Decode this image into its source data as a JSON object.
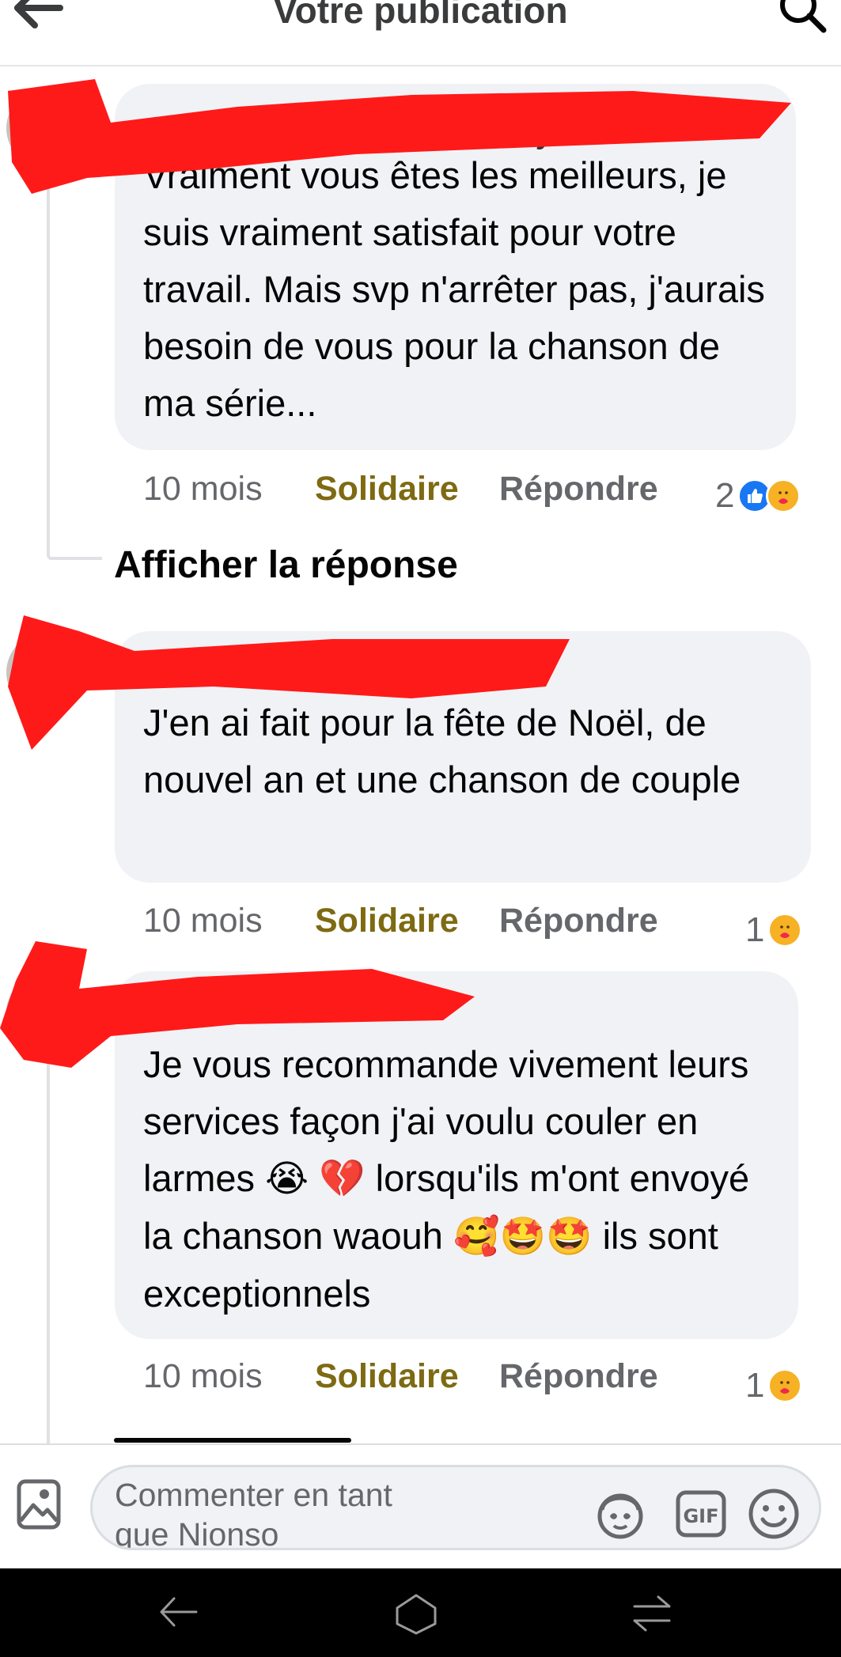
{
  "header": {
    "title": "Votre publication",
    "back_icon": "arrow-left-icon",
    "search_icon": "search-icon"
  },
  "comments": [
    {
      "text": "Vraiment vous êtes les meilleurs, je suis vraiment satisfait pour votre travail. Mais svp n'arrêter pas, j'aurais besoin de vous pour la chanson de ma série...",
      "time": "10 mois",
      "like_label": "Solidaire",
      "reply_label": "Répondre",
      "reaction_count": "2",
      "reactions": [
        "like",
        "care"
      ]
    },
    {
      "text": "J'en ai fait pour la fête de Noël, de nouvel an et une chanson de couple",
      "time": "10 mois",
      "like_label": "Solidaire",
      "reply_label": "Répondre",
      "reaction_count": "1",
      "reactions": [
        "care"
      ]
    },
    {
      "text_parts": [
        "Je vous recommande vivement leurs services façon j'ai voulu couler en larmes ",
        "😭",
        " ",
        "💔",
        " lorsqu'ils m'ont envoyé la chanson waouh ",
        "🥰🤩🤩",
        " ils sont exceptionnels"
      ],
      "time": "10 mois",
      "like_label": "Solidaire",
      "reply_label": "Répondre",
      "reaction_count": "1",
      "reactions": [
        "care"
      ]
    }
  ],
  "show_reply_label": "Afficher la réponse",
  "composer": {
    "placeholder": "Commenter en tant que Nionso",
    "icons": [
      "photo-icon",
      "avatar-sticker-icon",
      "gif-icon",
      "emoji-icon"
    ]
  },
  "colors": {
    "like_action": "#7e6a12",
    "bubble": "#f0f2f5",
    "redaction": "#ff0000"
  }
}
